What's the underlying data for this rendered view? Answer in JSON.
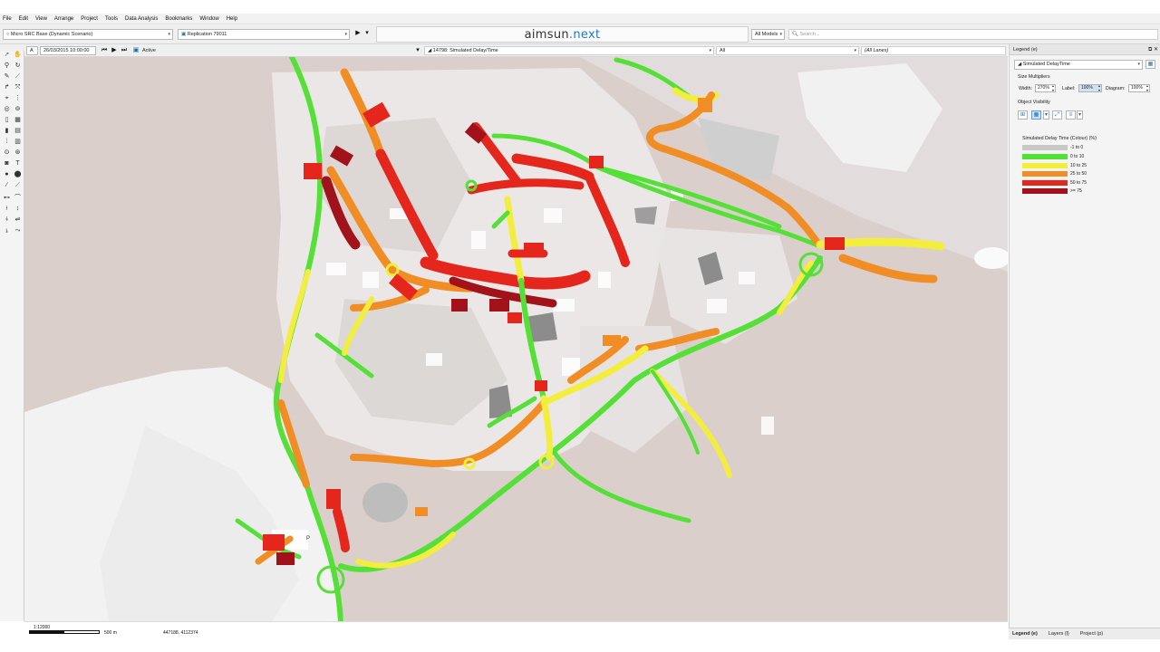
{
  "menu": [
    "File",
    "Edit",
    "View",
    "Arrange",
    "Project",
    "Tools",
    "Data Analysis",
    "Bookmarks",
    "Window",
    "Help"
  ],
  "toolbar": {
    "scenario": "Micro SRC Base (Dynamic Scenario)",
    "replication": "Replication 79011",
    "brand_main": "aimsun",
    "brand_dot": ".next",
    "models": "All Models",
    "search_placeholder": "Search..."
  },
  "sim_bar": {
    "mode": "A",
    "datetime": "26/03/2015 10:00:00",
    "status": "Active",
    "view_mode": "14798: Simulated Delay/Time",
    "filter": "All",
    "lanes": "(All Lanes)"
  },
  "legend_panel": {
    "header": "Legend (e)",
    "mode": "Simulated DelayTime",
    "size_multipliers_label": "Size Multipliers",
    "width_label": "Width:",
    "width_value": "270%",
    "label_label": "Label:",
    "label_value": "100%",
    "diagram_label": "Diagram:",
    "diagram_value": "100%",
    "object_visibility_label": "Object Visibility",
    "legend_title": "Simulated Delay Time (Colour) (%)",
    "entries": [
      {
        "label": "-1 to 0",
        "color": "#c8c8c8"
      },
      {
        "label": "0 to 10",
        "color": "#55e037"
      },
      {
        "label": "10 to 25",
        "color": "#f3ee3e"
      },
      {
        "label": "25 to 50",
        "color": "#f08d24"
      },
      {
        "label": "50 to 75",
        "color": "#e4261c"
      },
      {
        "label": ">= 75",
        "color": "#a2121a"
      }
    ]
  },
  "bottom_tabs": [
    "Legend (e)",
    "Layers (l)",
    "Project (p)"
  ],
  "status": {
    "scale": "1:12000",
    "distance": "500 m",
    "coordinates": "447188, 4112374"
  },
  "map_labels": {
    "parking": "P"
  }
}
